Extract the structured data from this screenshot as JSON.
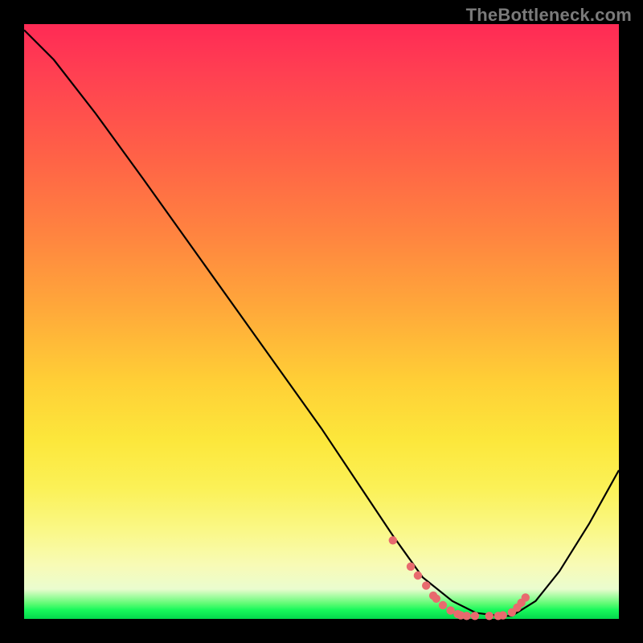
{
  "watermark": "TheBottleneck.com",
  "chart_data": {
    "type": "line",
    "title": "",
    "xlabel": "",
    "ylabel": "",
    "ylim": [
      0,
      100
    ],
    "xlim": [
      0,
      100
    ],
    "notes": "Gradient background encodes bottleneck severity (red=high, green=low). Curve is the bottleneck percentage vs an implicit x-axis. Pink markers highlight the optimal (near-zero) region.",
    "series": [
      {
        "name": "bottleneck-curve",
        "x": [
          0,
          5,
          12,
          20,
          30,
          40,
          50,
          58,
          62,
          67,
          72,
          76,
          80,
          82,
          86,
          90,
          95,
          100
        ],
        "values": [
          99,
          94,
          85,
          74,
          60,
          46,
          32,
          20,
          14,
          7,
          3,
          1,
          0.5,
          0.5,
          3,
          8,
          16,
          25
        ]
      }
    ],
    "markers": {
      "color": "#e86a6e",
      "points_x": [
        62.0,
        65.0,
        66.2,
        67.6,
        68.8,
        69.3,
        70.4,
        71.7,
        72.9,
        73.4,
        74.4,
        75.8,
        78.2,
        79.7,
        80.5,
        82.0,
        82.9,
        83.6,
        84.3
      ],
      "points_y": [
        13.2,
        8.8,
        7.3,
        5.6,
        3.9,
        3.4,
        2.3,
        1.4,
        0.8,
        0.6,
        0.5,
        0.5,
        0.5,
        0.5,
        0.6,
        1.1,
        1.9,
        2.7,
        3.6
      ]
    },
    "background_gradient_stops": [
      {
        "pct": 0,
        "color": "#ff2a55"
      },
      {
        "pct": 22,
        "color": "#ff6147"
      },
      {
        "pct": 48,
        "color": "#ffa93a"
      },
      {
        "pct": 70,
        "color": "#fce73b"
      },
      {
        "pct": 91,
        "color": "#f8fbb6"
      },
      {
        "pct": 97.5,
        "color": "#5bfb72"
      },
      {
        "pct": 100,
        "color": "#04d84d"
      }
    ]
  }
}
